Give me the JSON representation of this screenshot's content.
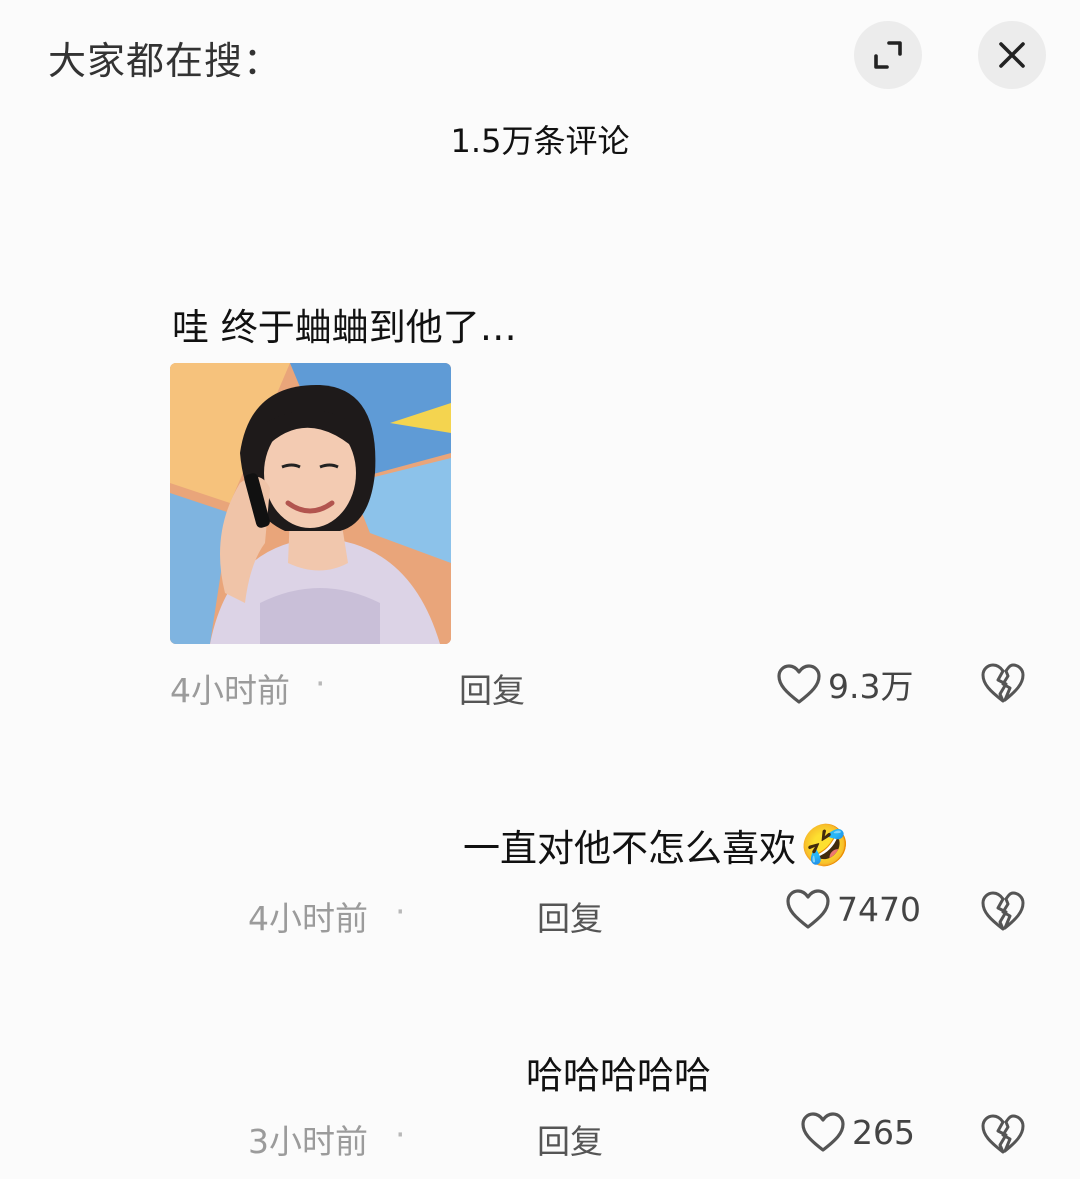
{
  "header": {
    "title": "大家都在搜："
  },
  "panel": {
    "comment_count": "1.5万条评论"
  },
  "comments": [
    {
      "text": "哇 终于蛐蛐到他了…",
      "time": "4小时前",
      "separator": "·",
      "reply_label": "回复",
      "likes": "9.3万",
      "has_image": true
    },
    {
      "text": "一直对他不怎么喜欢",
      "emoji": "🤣",
      "time": "4小时前",
      "separator": "·",
      "reply_label": "回复",
      "likes": "7470"
    },
    {
      "text": "哈哈哈哈哈",
      "time": "3小时前",
      "separator": "·",
      "reply_label": "回复",
      "likes": "265"
    }
  ],
  "icons": {
    "expand": "expand-icon",
    "close": "close-icon",
    "heart": "heart-icon",
    "dislike": "broken-heart-icon"
  }
}
